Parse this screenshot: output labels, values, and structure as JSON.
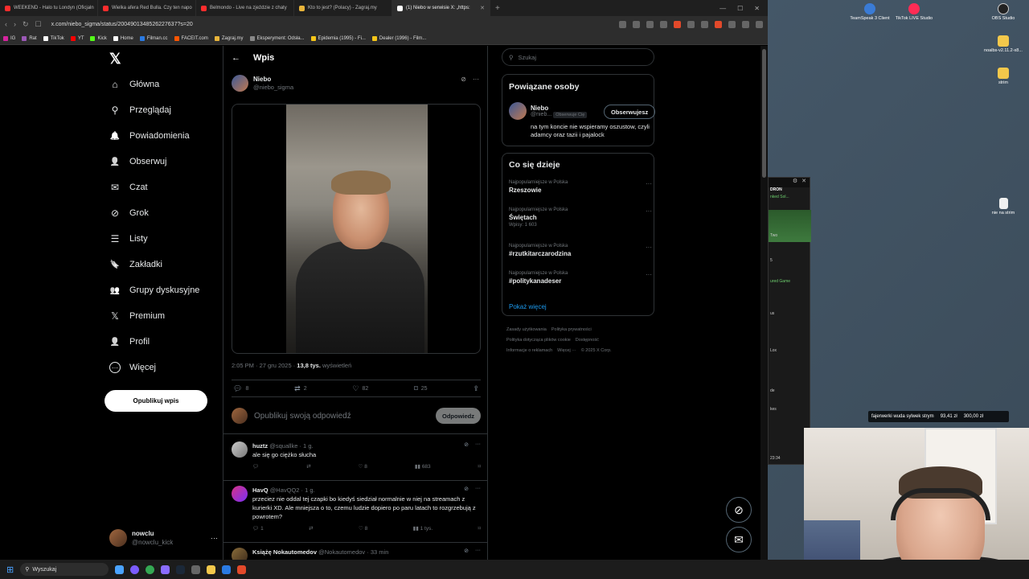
{
  "browser": {
    "tabs": [
      {
        "title": "WEEKEND - Halo tu Londyn (Oficjaln",
        "color": "#ff2d2d"
      },
      {
        "title": "Wielka afera Red Bulla. Czy ten napo",
        "color": "#ff2d2d"
      },
      {
        "title": "Belmondo - Live na zjeździe z chaty",
        "color": "#ff2d2d"
      },
      {
        "title": "Kto to jest? (Polacy) - Zagraj.my",
        "color": "#e8b43a"
      },
      {
        "title": "(1) Niebo w serwisie X: „https:",
        "color": "#ffffff",
        "active": true
      }
    ],
    "url": "x.com/niebo_sigma/status/2004901348526227637?s=20",
    "bookmarks": [
      {
        "label": "IG",
        "color": "#d6249f"
      },
      {
        "label": "Rat",
        "color": "#9b59b6"
      },
      {
        "label": "TikTok",
        "color": "#ffffff"
      },
      {
        "label": "YT",
        "color": "#ff0000"
      },
      {
        "label": "Kick",
        "color": "#53fc18"
      },
      {
        "label": "Home",
        "color": "#ffffff"
      },
      {
        "label": "Filman.cc",
        "color": "#2a7ae2"
      },
      {
        "label": "FACEIT.com",
        "color": "#ff5500"
      },
      {
        "label": "Zagraj.my",
        "color": "#e8b43a"
      },
      {
        "label": "Eksperyment: Odsła...",
        "color": "#888888"
      },
      {
        "label": "Epidemia (1995) - Fi...",
        "color": "#f5c518"
      },
      {
        "label": "Dealer (1996) - Film...",
        "color": "#f5c518"
      }
    ]
  },
  "nav": {
    "logo": "𝕏",
    "items": [
      {
        "label": "Główna",
        "icon": "home-icon",
        "glyph": "⌂"
      },
      {
        "label": "Przeglądaj",
        "icon": "search-icon",
        "glyph": "⚲"
      },
      {
        "label": "Powiadomienia",
        "icon": "bell-icon",
        "glyph": "🔔"
      },
      {
        "label": "Obserwuj",
        "icon": "follow-icon",
        "glyph": "👤"
      },
      {
        "label": "Czat",
        "icon": "mail-icon",
        "glyph": "✉"
      },
      {
        "label": "Grok",
        "icon": "grok-icon",
        "glyph": "⊘"
      },
      {
        "label": "Listy",
        "icon": "list-icon",
        "glyph": "☰"
      },
      {
        "label": "Zakładki",
        "icon": "bookmark-icon",
        "glyph": "🔖"
      },
      {
        "label": "Grupy dyskusyjne",
        "icon": "community-icon",
        "glyph": "👥"
      },
      {
        "label": "Premium",
        "icon": "x-premium-icon",
        "glyph": "𝕏"
      },
      {
        "label": "Profil",
        "icon": "profile-icon",
        "glyph": "👤"
      },
      {
        "label": "Więcej",
        "icon": "more-circle-icon",
        "glyph": "⋯"
      }
    ],
    "post_button": "Opublikuj wpis",
    "account": {
      "name": "nowclu",
      "handle": "@nowclu_kick"
    }
  },
  "post": {
    "header_title": "Wpis",
    "author_name": "Niebo",
    "author_handle": "@niebo_sigma",
    "time": "2:05 PM · 27 gru 2025 · ",
    "views_count": "13,8 tys.",
    "views_label": "wyświetleń",
    "replies": "8",
    "reposts": "2",
    "likes": "82",
    "bookmarks": "25",
    "reply_placeholder": "Opublikuj swoją odpowiedź",
    "reply_button": "Odpowiedz"
  },
  "replies": [
    {
      "name": "huztz",
      "meta": "@squallke · 1 g.",
      "text": "ale się go ciężko słucha",
      "likes": "8",
      "views": "683",
      "reposts": "",
      "comments": ""
    },
    {
      "name": "HavQ",
      "meta": "@HavQQ2 · 1 g.",
      "text": "przeciez nie oddal tej czapki bo kiedyś siedział normalnie w niej na streamach z kurierki XD. Ale mniejsza o to, czemu ludzie dopiero po paru latach to rozgrzebują z powrotem?",
      "likes": "8",
      "views": "1 tys.",
      "reposts": "",
      "comments": "1"
    },
    {
      "name": "Książę Nokautomedov",
      "meta": "@Nokautomedov · 33 min",
      "text": "",
      "likes": "",
      "views": "",
      "reposts": "",
      "comments": ""
    }
  ],
  "sidebar": {
    "search_placeholder": "Szukaj",
    "related_title": "Powiązane osoby",
    "related": {
      "name": "Niebo",
      "handle": "@nieb...",
      "follows_badge": "Obserwuje Cię",
      "button": "Obserwujesz",
      "bio": "na tym koncie nie wspieramy oszustow, czyli adamcy oraz tazii i pajalock"
    },
    "trends_title": "Co się dzieje",
    "trends": [
      {
        "label": "Najpopularniejsze w Polska",
        "name": "Rzeszowie",
        "count": ""
      },
      {
        "label": "Najpopularniejsze w Polska",
        "name": "Świętach",
        "count": "Wpisy: 1 603"
      },
      {
        "label": "Najpopularniejsze w Polska",
        "name": "#rzutkitarczarodzina",
        "count": ""
      },
      {
        "label": "Najpopularniejsze w Polska",
        "name": "#politykanadeser",
        "count": ""
      }
    ],
    "show_more": "Pokaż więcej",
    "footer": [
      "Zasady użytkowania",
      "Polityka prywatności",
      "Polityka dotycząca plików cookie",
      "Dostępność",
      "Informacje o reklamach",
      "Więcej ···",
      "© 2025 X Corp."
    ]
  },
  "desktop": {
    "icons": [
      "TeamSpeak 3 Client",
      "TikTok LIVE Studio",
      "OBS Studio",
      "noalbs-v2.11.2-x8...",
      "strim",
      "nie na strim"
    ],
    "donation_text": "fajerwerki wuda sylwek strym",
    "donation_amount1": "93,41 zł",
    "donation_amount2": "300,00 zł",
    "mini_title": "DRON",
    "mini_sub": "nked Sol...",
    "mini_tag": "Two",
    "mini_labels": [
      "5",
      "ured Game",
      "us",
      "Lox",
      "de",
      "kes"
    ],
    "mini_time": "23:34"
  },
  "taskbar": {
    "search_label": "Wyszukaj"
  }
}
